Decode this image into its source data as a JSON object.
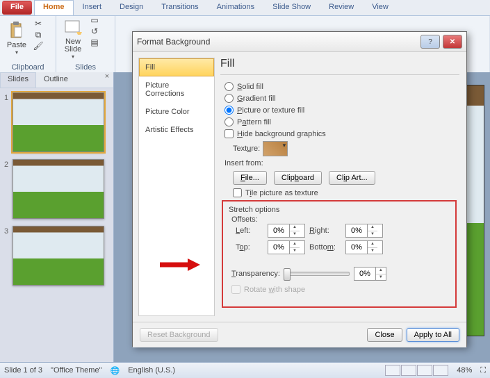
{
  "tabs": {
    "file": "File",
    "home": "Home",
    "insert": "Insert",
    "design": "Design",
    "transitions": "Transitions",
    "animations": "Animations",
    "slideshow": "Slide Show",
    "review": "Review",
    "view": "View"
  },
  "ribbon": {
    "clipboard": {
      "label": "Clipboard",
      "paste": "Paste"
    },
    "slides": {
      "label": "Slides",
      "new": "New\nSlide"
    }
  },
  "nav": {
    "slides": "Slides",
    "outline": "Outline"
  },
  "thumbs": [
    "1",
    "2",
    "3"
  ],
  "dialog": {
    "title": "Format Background",
    "cats": [
      "Fill",
      "Picture Corrections",
      "Picture Color",
      "Artistic Effects"
    ],
    "heading": "Fill",
    "solid": "Solid fill",
    "grad": "Gradient fill",
    "pictex": "Picture or texture fill",
    "pattern": "Pattern fill",
    "hidebg": "Hide background graphics",
    "texture": "Texture:",
    "insertfrom": "Insert from:",
    "file": "File...",
    "clip": "Clipboard",
    "clipart": "Clip Art...",
    "tile": "Tile picture as texture",
    "stretch": "Stretch options",
    "offsets": "Offsets:",
    "left": "Left:",
    "right": "Right:",
    "top": "Top:",
    "bottom": "Bottom:",
    "transparency": "Transparency:",
    "rotate": "Rotate with shape",
    "val": "0%",
    "reset": "Reset Background",
    "close": "Close",
    "apply": "Apply to All"
  },
  "status": {
    "slide": "Slide 1 of 3",
    "theme": "\"Office Theme\"",
    "lang": "English (U.S.)",
    "zoom": "48%"
  }
}
